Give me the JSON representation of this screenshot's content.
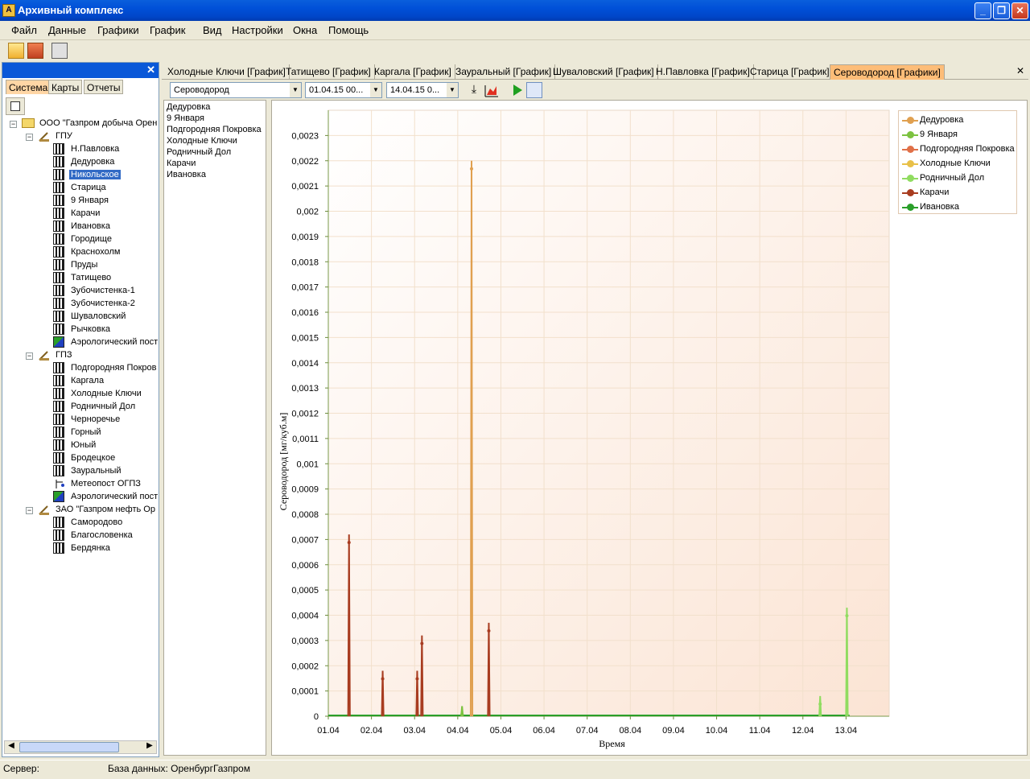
{
  "window": {
    "title": "Архивный комплекс",
    "icon": "app-icon"
  },
  "menu": [
    "Файл",
    "Данные",
    "Графики",
    "График",
    "Вид",
    "Настройки",
    "Окна",
    "Помощь"
  ],
  "left_panel": {
    "tabs": [
      "Система",
      "Карты",
      "Отчеты"
    ],
    "tree": [
      {
        "label": "ООО \"Газпром добыча Орен",
        "level": 0,
        "icon": "folder-icon",
        "expander": "−"
      },
      {
        "label": "ГПУ",
        "level": 1,
        "icon": "tool-icon",
        "expander": "−"
      },
      {
        "label": "Н.Павловка",
        "level": 2,
        "icon": "station-icon"
      },
      {
        "label": "Дедуровка",
        "level": 2,
        "icon": "station-icon"
      },
      {
        "label": "Никольское",
        "level": 2,
        "icon": "station-icon",
        "selected": true
      },
      {
        "label": "Старица",
        "level": 2,
        "icon": "station-icon"
      },
      {
        "label": "9 Января",
        "level": 2,
        "icon": "station-icon"
      },
      {
        "label": "Карачи",
        "level": 2,
        "icon": "station-icon"
      },
      {
        "label": "Ивановка",
        "level": 2,
        "icon": "station-icon"
      },
      {
        "label": "Городище",
        "level": 2,
        "icon": "station-icon"
      },
      {
        "label": "Краснохолм",
        "level": 2,
        "icon": "station-icon"
      },
      {
        "label": "Пруды",
        "level": 2,
        "icon": "station-icon"
      },
      {
        "label": "Татищево",
        "level": 2,
        "icon": "station-icon"
      },
      {
        "label": "Зубочистенка-1",
        "level": 2,
        "icon": "station-icon"
      },
      {
        "label": "Зубочистенка-2",
        "level": 2,
        "icon": "station-icon"
      },
      {
        "label": "Шуваловский",
        "level": 2,
        "icon": "station-icon"
      },
      {
        "label": "Рычковка",
        "level": 2,
        "icon": "station-icon"
      },
      {
        "label": "Аэрологический пост",
        "level": 2,
        "icon": "aero-icon"
      },
      {
        "label": "ГПЗ",
        "level": 1,
        "icon": "tool-icon",
        "expander": "−"
      },
      {
        "label": "Подгородняя Покров",
        "level": 2,
        "icon": "station-icon"
      },
      {
        "label": "Каргала",
        "level": 2,
        "icon": "station-icon"
      },
      {
        "label": "Холодные Ключи",
        "level": 2,
        "icon": "station-icon"
      },
      {
        "label": "Родничный Дол",
        "level": 2,
        "icon": "station-icon"
      },
      {
        "label": "Чернoречье",
        "level": 2,
        "icon": "station-icon"
      },
      {
        "label": "Горный",
        "level": 2,
        "icon": "station-icon"
      },
      {
        "label": "Юный",
        "level": 2,
        "icon": "station-icon"
      },
      {
        "label": "Бродецкое",
        "level": 2,
        "icon": "station-icon"
      },
      {
        "label": "Зауральный",
        "level": 2,
        "icon": "station-icon"
      },
      {
        "label": "Метеопост ОГПЗ",
        "level": 2,
        "icon": "meteo-icon"
      },
      {
        "label": "Аэрологический пост",
        "level": 2,
        "icon": "aero-icon"
      },
      {
        "label": "ЗАО \"Газпром нефть Ор",
        "level": 1,
        "icon": "tool-icon",
        "expander": "−"
      },
      {
        "label": "Самородово",
        "level": 2,
        "icon": "station-icon"
      },
      {
        "label": "Благословенка",
        "level": 2,
        "icon": "station-icon"
      },
      {
        "label": "Бердянка",
        "level": 2,
        "icon": "station-icon"
      }
    ]
  },
  "doc_tabs": [
    "Холодные Ключи [График]",
    "Татищево [График]",
    "Каргала [График]",
    "Зауральный [График]",
    "Шуваловский [График]",
    "Н.Павловка [График]",
    "Старица [График]",
    "Сероводород [Графики]"
  ],
  "chart_toolbar": {
    "substance": "Сероводород",
    "date_from": "01.04.15 00...",
    "date_to": "14.04.15 0..."
  },
  "station_list": [
    "Дедуровка",
    "9 Января",
    "Подгородняя Покровка",
    "Холодные Ключи",
    "Родничный Дол",
    "Карачи",
    "Ивановка"
  ],
  "status": {
    "server_label": "Сервер:",
    "db_label": "База данных: ОренбургГазпром"
  },
  "chart_data": {
    "type": "line",
    "xlabel": "Время",
    "ylabel": "Сероводород [мг/куб.м]",
    "x_ticks": [
      "01.04",
      "02.04",
      "03.04",
      "04.04",
      "05.04",
      "06.04",
      "07.04",
      "08.04",
      "09.04",
      "10.04",
      "11.04",
      "12.04",
      "13.04"
    ],
    "y_ticks": [
      "0",
      "0,0001",
      "0,0002",
      "0,0003",
      "0,0004",
      "0,0005",
      "0,0006",
      "0,0007",
      "0,0008",
      "0,0009",
      "0,001",
      "0,0011",
      "0,0012",
      "0,0013",
      "0,0014",
      "0,0015",
      "0,0016",
      "0,0017",
      "0,0018",
      "0,0019",
      "0,002",
      "0,0021",
      "0,0022",
      "0,0023"
    ],
    "xlim": [
      0,
      13
    ],
    "ylim": [
      0,
      0.0024
    ],
    "series": [
      {
        "name": "Дедуровка",
        "color": "#e0a050",
        "points": [
          [
            3.3,
            0
          ],
          [
            3.32,
            0.0022
          ],
          [
            3.34,
            0
          ]
        ]
      },
      {
        "name": "9 Января",
        "color": "#7cc240",
        "points": [
          [
            3.08,
            0
          ],
          [
            3.1,
            4e-05
          ],
          [
            3.12,
            0
          ]
        ]
      },
      {
        "name": "Подгородняя Покровка",
        "color": "#e07048",
        "points": []
      },
      {
        "name": "Холодные Ключи",
        "color": "#e8c048",
        "points": []
      },
      {
        "name": "Родничный Дол",
        "color": "#90dc60",
        "points": [
          [
            11.38,
            0
          ],
          [
            11.4,
            8e-05
          ],
          [
            11.42,
            0
          ],
          [
            12.0,
            0
          ],
          [
            12.02,
            0.00043
          ],
          [
            12.04,
            0
          ]
        ]
      },
      {
        "name": "Карачи",
        "color": "#a83c20",
        "points": [
          [
            0.46,
            0
          ],
          [
            0.48,
            0.00072
          ],
          [
            0.5,
            0
          ],
          [
            1.24,
            0
          ],
          [
            1.26,
            0.00018
          ],
          [
            1.28,
            0
          ],
          [
            2.04,
            0
          ],
          [
            2.06,
            0.00018
          ],
          [
            2.08,
            0
          ],
          [
            2.15,
            0
          ],
          [
            2.17,
            0.00032
          ],
          [
            2.19,
            0
          ],
          [
            3.7,
            0
          ],
          [
            3.72,
            0.00037
          ],
          [
            3.74,
            0
          ]
        ]
      },
      {
        "name": "Ивановка",
        "color": "#2a9f2a",
        "points": []
      }
    ],
    "legend_position": "top-right",
    "grid": true
  }
}
